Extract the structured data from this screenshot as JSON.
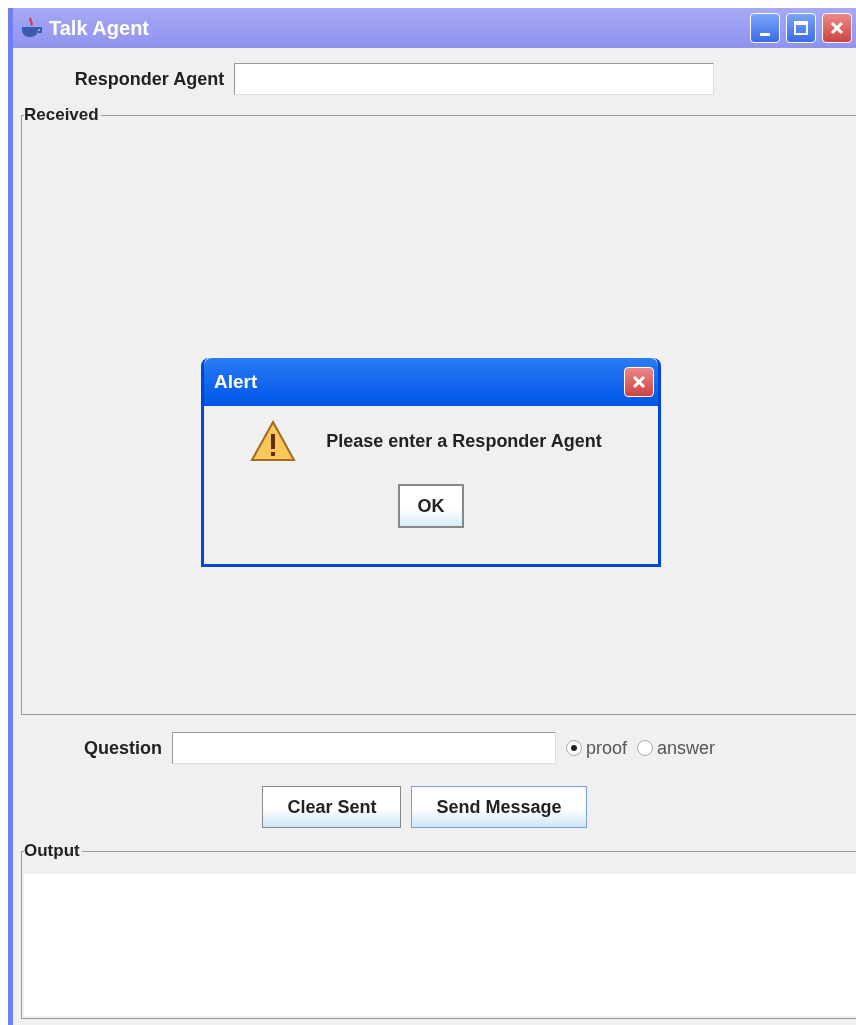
{
  "window": {
    "title": "Talk Agent"
  },
  "responder": {
    "label": "Responder Agent"
  },
  "received": {
    "title": "Received"
  },
  "dialog": {
    "title": "Alert",
    "message": "Please enter a Responder Agent",
    "button": "OK"
  },
  "question": {
    "label": "Question"
  },
  "modes": [
    {
      "label": "proof",
      "selected": true
    },
    {
      "label": "answer",
      "selected": false
    }
  ],
  "buttons": [
    {
      "label": "Clear Sent",
      "focused": false
    },
    {
      "label": "Send Message",
      "focused": true
    }
  ],
  "output": {
    "title": "Output"
  }
}
